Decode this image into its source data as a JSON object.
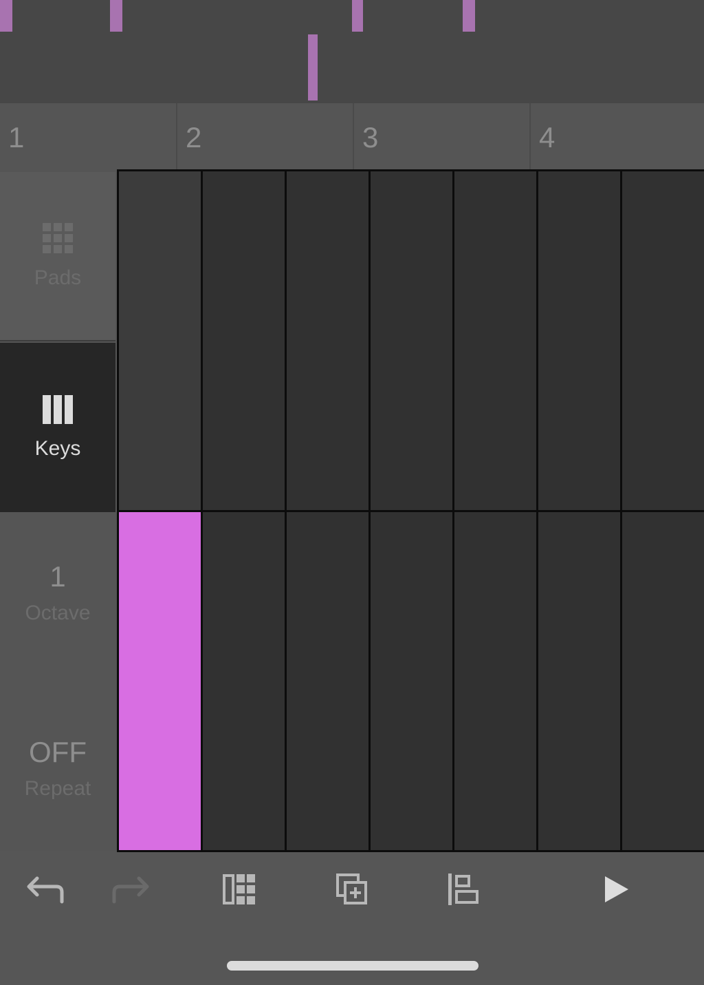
{
  "overview": {
    "note_color": "#a873b0"
  },
  "ruler": {
    "bars": [
      "1",
      "2",
      "3",
      "4"
    ]
  },
  "sidebar": {
    "pads": {
      "label": "Pads",
      "icon": "grid-icon"
    },
    "keys": {
      "label": "Keys",
      "icon": "piano-keys-icon",
      "selected": true
    },
    "octave": {
      "value": "1",
      "label": "Octave"
    },
    "repeat": {
      "value": "OFF",
      "label": "Repeat"
    }
  },
  "grid": {
    "columns": 7,
    "rows": 2,
    "active_cell": {
      "row": 2,
      "column": 1
    },
    "active_color": "#d86ee2"
  },
  "toolbar": {
    "items": [
      {
        "name": "undo",
        "icon": "undo-icon",
        "enabled": true
      },
      {
        "name": "redo",
        "icon": "redo-icon",
        "enabled": false
      },
      {
        "name": "layout",
        "icon": "layout-grid-icon",
        "enabled": true
      },
      {
        "name": "duplicate",
        "icon": "duplicate-add-icon",
        "enabled": true
      },
      {
        "name": "align",
        "icon": "align-left-icon",
        "enabled": true
      },
      {
        "name": "play",
        "icon": "play-icon",
        "enabled": true
      }
    ]
  }
}
